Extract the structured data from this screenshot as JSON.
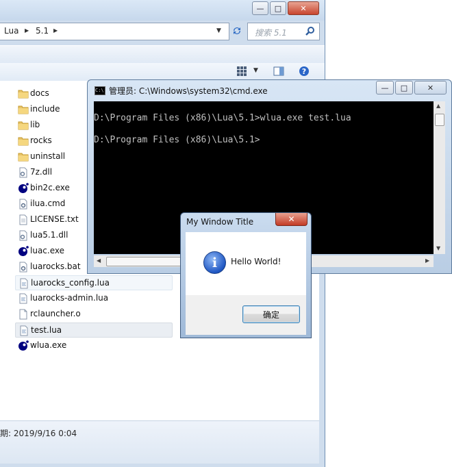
{
  "explorer": {
    "breadcrumb": [
      "Lua",
      "5.1"
    ],
    "search_placeholder": "搜索 5.1",
    "status_text": "期: 2019/9/16 0:04",
    "files": [
      {
        "name": "docs",
        "icon": "folder-icon"
      },
      {
        "name": "include",
        "icon": "folder-icon"
      },
      {
        "name": "lib",
        "icon": "folder-icon"
      },
      {
        "name": "rocks",
        "icon": "folder-icon"
      },
      {
        "name": "uninstall",
        "icon": "folder-icon"
      },
      {
        "name": "7z.dll",
        "icon": "dll-file-icon"
      },
      {
        "name": "bin2c.exe",
        "icon": "lua-exe-icon"
      },
      {
        "name": "ilua.cmd",
        "icon": "cmd-file-icon"
      },
      {
        "name": "LICENSE.txt",
        "icon": "text-file-icon"
      },
      {
        "name": "lua5.1.dll",
        "icon": "dll-file-icon"
      },
      {
        "name": "luac.exe",
        "icon": "lua-exe-icon"
      },
      {
        "name": "luarocks.bat",
        "icon": "batch-file-icon"
      },
      {
        "name": "luarocks_config.lua",
        "icon": "lua-file-icon"
      },
      {
        "name": "luarocks-admin.lua",
        "icon": "lua-file-icon"
      },
      {
        "name": "rclauncher.o",
        "icon": "generic-file-icon"
      },
      {
        "name": "test.lua",
        "icon": "lua-file-icon"
      },
      {
        "name": "wlua.exe",
        "icon": "lua-exe-icon"
      }
    ]
  },
  "cmd": {
    "title": "管理员: C:\\Windows\\system32\\cmd.exe",
    "lines": [
      "D:\\Program Files (x86)\\Lua\\5.1>wlua.exe test.lua",
      "D:\\Program Files (x86)\\Lua\\5.1>"
    ]
  },
  "msgbox": {
    "title": "My Window Title",
    "message": "Hello World!",
    "ok_label": "确定"
  },
  "colors": {
    "console_bg": "#000000",
    "console_fg": "#c0c0c0",
    "aero_frame": "#c6d8ec",
    "close_red": "#c8452e"
  }
}
